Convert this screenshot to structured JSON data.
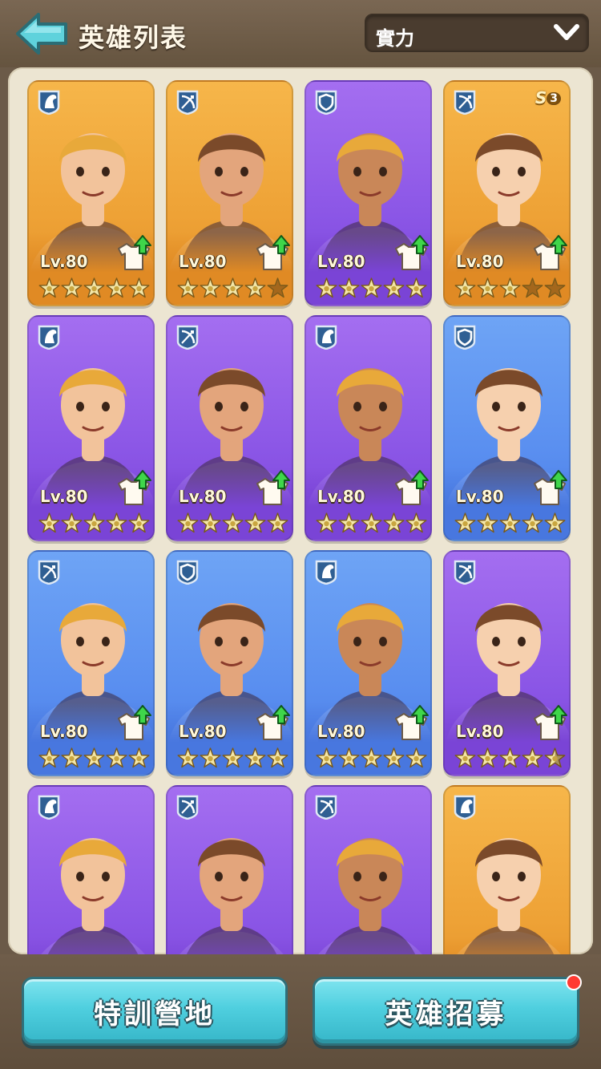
{
  "header": {
    "title": "英雄列表",
    "sort_value": "實力",
    "icons": {
      "back": "back-arrow-icon",
      "dropdown": "chevron-down-icon"
    }
  },
  "colors": {
    "orange": "#eea236",
    "purple": "#8b56e6",
    "blue": "#5a8ff0",
    "button": "#4fcfdf",
    "star": "#f4e7a8",
    "upgrade_arrow": "#3fd64a"
  },
  "heroes": [
    {
      "color": "orange",
      "class": "cavalry",
      "level": "Lv.80",
      "stars": 5,
      "badge": null
    },
    {
      "color": "orange",
      "class": "archer",
      "level": "Lv.80",
      "stars": 4,
      "badge": null
    },
    {
      "color": "purple",
      "class": "shield",
      "level": "Lv.80",
      "stars": 5,
      "badge": null
    },
    {
      "color": "orange",
      "class": "archer",
      "level": "Lv.80",
      "stars": 3,
      "badge": "S",
      "badge_num": "3"
    },
    {
      "color": "purple",
      "class": "cavalry",
      "level": "Lv.80",
      "stars": 5,
      "badge": null
    },
    {
      "color": "purple",
      "class": "archer",
      "level": "Lv.80",
      "stars": 5,
      "badge": null
    },
    {
      "color": "purple",
      "class": "cavalry",
      "level": "Lv.80",
      "stars": 5,
      "badge": null
    },
    {
      "color": "blue",
      "class": "shield",
      "level": "Lv.80",
      "stars": 5,
      "badge": null
    },
    {
      "color": "blue",
      "class": "archer",
      "level": "Lv.80",
      "stars": 5,
      "badge": null
    },
    {
      "color": "blue",
      "class": "shield",
      "level": "Lv.80",
      "stars": 5,
      "badge": null
    },
    {
      "color": "blue",
      "class": "cavalry",
      "level": "Lv.80",
      "stars": 5,
      "badge": null
    },
    {
      "color": "purple",
      "class": "archer",
      "level": "Lv.80",
      "stars": 4.5,
      "badge": null
    },
    {
      "color": "purple",
      "class": "cavalry",
      "level": "",
      "stars": 0,
      "badge": null
    },
    {
      "color": "purple",
      "class": "archer",
      "level": "",
      "stars": 0,
      "badge": null
    },
    {
      "color": "purple",
      "class": "archer",
      "level": "",
      "stars": 0,
      "badge": null
    },
    {
      "color": "orange",
      "class": "cavalry",
      "level": "",
      "stars": 0,
      "badge": null
    }
  ],
  "buttons": {
    "training": "特訓營地",
    "recruit": "英雄招募"
  }
}
